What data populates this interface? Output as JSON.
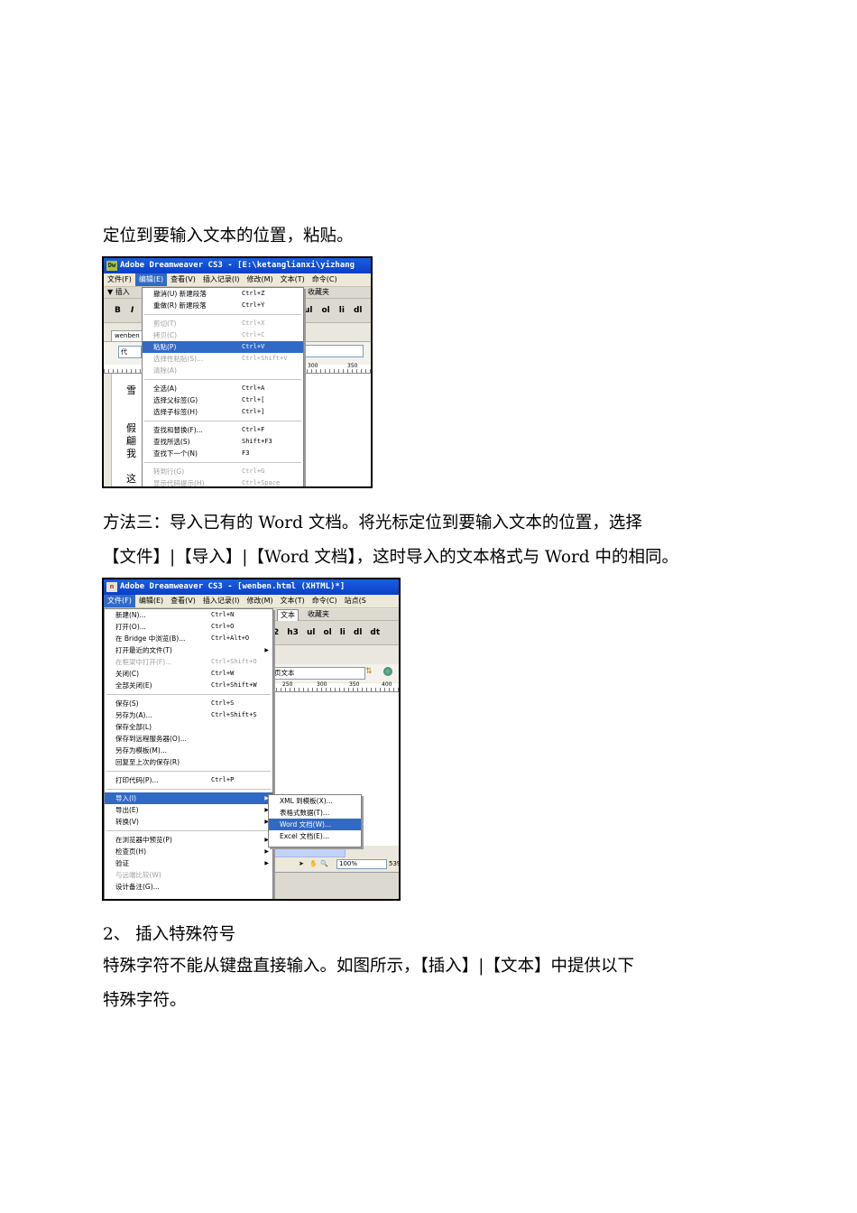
{
  "paragraphs": {
    "p1": "定位到要输入文本的位置，粘贴。",
    "p2": "方法三：导入已有的 Word 文档。将光标定位到要输入文本的位置，选择",
    "p3": "【文件】|【导入】|【Word 文档】，这时导入的文本格式与 Word 中的相同。",
    "p4": "2、 插入特殊符号",
    "p5": "特殊字符不能从键盘直接输入。如图所示，【插入】|【文本】中提供以下",
    "p6": "特殊字符。"
  },
  "shot1": {
    "title": "Adobe Dreamweaver CS3 - [E:\\ketanglianxi\\yizhang",
    "menubar": [
      "文件(F)",
      "编辑(E)",
      "查看(V)",
      "插入记录(I)",
      "修改(M)",
      "文本(T)",
      "命令(C)"
    ],
    "insert_tab": "▼ 插入",
    "favorites": "收藏夹",
    "tool_buttons": [
      "ul",
      "ol",
      "li",
      "dl"
    ],
    "doc_tab": "wenben",
    "code_btn": "代",
    "ruler_marks": [
      "300",
      "350"
    ],
    "doc_lines": [
      "雪",
      "假",
      "翩",
      "我",
      "这"
    ],
    "edit_menu": [
      {
        "label": "撤消(U) 新建段落",
        "shortcut": "Ctrl+Z",
        "disabled": false
      },
      {
        "label": "重做(R) 新建段落",
        "shortcut": "Ctrl+Y",
        "disabled": false
      },
      {
        "sep": true
      },
      {
        "label": "剪切(T)",
        "shortcut": "Ctrl+X",
        "disabled": true
      },
      {
        "label": "拷贝(C)",
        "shortcut": "Ctrl+C",
        "disabled": true
      },
      {
        "label": "粘贴(P)",
        "shortcut": "Ctrl+V",
        "disabled": false,
        "highlight": true
      },
      {
        "label": "选择性粘贴(S)...",
        "shortcut": "Ctrl+Shift+V",
        "disabled": true
      },
      {
        "label": "清除(A)",
        "shortcut": "",
        "disabled": true
      },
      {
        "sep": true
      },
      {
        "label": "全选(A)",
        "shortcut": "Ctrl+A",
        "disabled": false
      },
      {
        "label": "选择父标签(G)",
        "shortcut": "Ctrl+[",
        "disabled": false
      },
      {
        "label": "选择子标签(H)",
        "shortcut": "Ctrl+]",
        "disabled": false
      },
      {
        "sep": true
      },
      {
        "label": "查找和替换(F)...",
        "shortcut": "Ctrl+F",
        "disabled": false
      },
      {
        "label": "查找所选(S)",
        "shortcut": "Shift+F3",
        "disabled": false
      },
      {
        "label": "查找下一个(N)",
        "shortcut": "F3",
        "disabled": false
      },
      {
        "sep": true
      },
      {
        "label": "转到行(G)",
        "shortcut": "Ctrl+G",
        "disabled": true
      },
      {
        "label": "显示代码提示(H)",
        "shortcut": "Ctrl+Space",
        "disabled": true
      }
    ]
  },
  "shot2": {
    "title": "Adobe Dreamweaver CS3 - [wenben.html (XHTML)*]",
    "menubar": [
      "文件(F)",
      "编辑(E)",
      "查看(V)",
      "插入记录(I)",
      "修改(M)",
      "文本(T)",
      "命令(C)",
      "站点(S"
    ],
    "tabs": [
      "文本",
      "收藏夹"
    ],
    "tool_buttons": [
      "2",
      "h3",
      "ul",
      "ol",
      "li",
      "dl",
      "dt"
    ],
    "title_field": "页文本",
    "ruler_marks": [
      "250",
      "300",
      "350",
      "400"
    ],
    "status": {
      "zoom": "100%",
      "size": "539"
    },
    "file_menu": [
      {
        "label": "新建(N)...",
        "shortcut": "Ctrl+N",
        "disabled": false
      },
      {
        "label": "打开(O)...",
        "shortcut": "Ctrl+O",
        "disabled": false
      },
      {
        "label": "在 Bridge 中浏览(B)...",
        "shortcut": "Ctrl+Alt+O",
        "disabled": false
      },
      {
        "label": "打开最近的文件(T)",
        "shortcut": "",
        "disabled": false,
        "submenu": true
      },
      {
        "label": "在框架中打开(F)...",
        "shortcut": "Ctrl+Shift+O",
        "disabled": true
      },
      {
        "label": "关闭(C)",
        "shortcut": "Ctrl+W",
        "disabled": false
      },
      {
        "label": "全部关闭(E)",
        "shortcut": "Ctrl+Shift+W",
        "disabled": false
      },
      {
        "sep": true
      },
      {
        "label": "保存(S)",
        "shortcut": "Ctrl+S",
        "disabled": false
      },
      {
        "label": "另存为(A)...",
        "shortcut": "Ctrl+Shift+S",
        "disabled": false
      },
      {
        "label": "保存全部(L)",
        "shortcut": "",
        "disabled": false
      },
      {
        "label": "保存到远程服务器(O)...",
        "shortcut": "",
        "disabled": false
      },
      {
        "label": "另存为模板(M)...",
        "shortcut": "",
        "disabled": false
      },
      {
        "label": "回复至上次的保存(R)",
        "shortcut": "",
        "disabled": false
      },
      {
        "sep": true
      },
      {
        "label": "打印代码(P)...",
        "shortcut": "Ctrl+P",
        "disabled": false
      },
      {
        "sep": true
      },
      {
        "label": "导入(I)",
        "shortcut": "",
        "disabled": false,
        "submenu": true,
        "highlight": true
      },
      {
        "label": "导出(E)",
        "shortcut": "",
        "disabled": false,
        "submenu": true
      },
      {
        "label": "转换(V)",
        "shortcut": "",
        "disabled": false,
        "submenu": true
      },
      {
        "sep": true
      },
      {
        "label": "在浏览器中预览(P)",
        "shortcut": "",
        "disabled": false,
        "submenu": true
      },
      {
        "label": "检查页(H)",
        "shortcut": "",
        "disabled": false,
        "submenu": true
      },
      {
        "label": "验证",
        "shortcut": "",
        "disabled": false,
        "submenu": true
      },
      {
        "label": "与远端比较(W)",
        "shortcut": "",
        "disabled": true
      },
      {
        "label": "设计备注(G)...",
        "shortcut": "",
        "disabled": false
      }
    ],
    "import_submenu": [
      {
        "label": "XML 到模板(X)...",
        "highlight": false
      },
      {
        "label": "表格式数据(T)...",
        "highlight": false
      },
      {
        "label": "Word 文档(W)...",
        "highlight": true
      },
      {
        "label": "Excel 文档(E)...",
        "highlight": false
      }
    ]
  }
}
